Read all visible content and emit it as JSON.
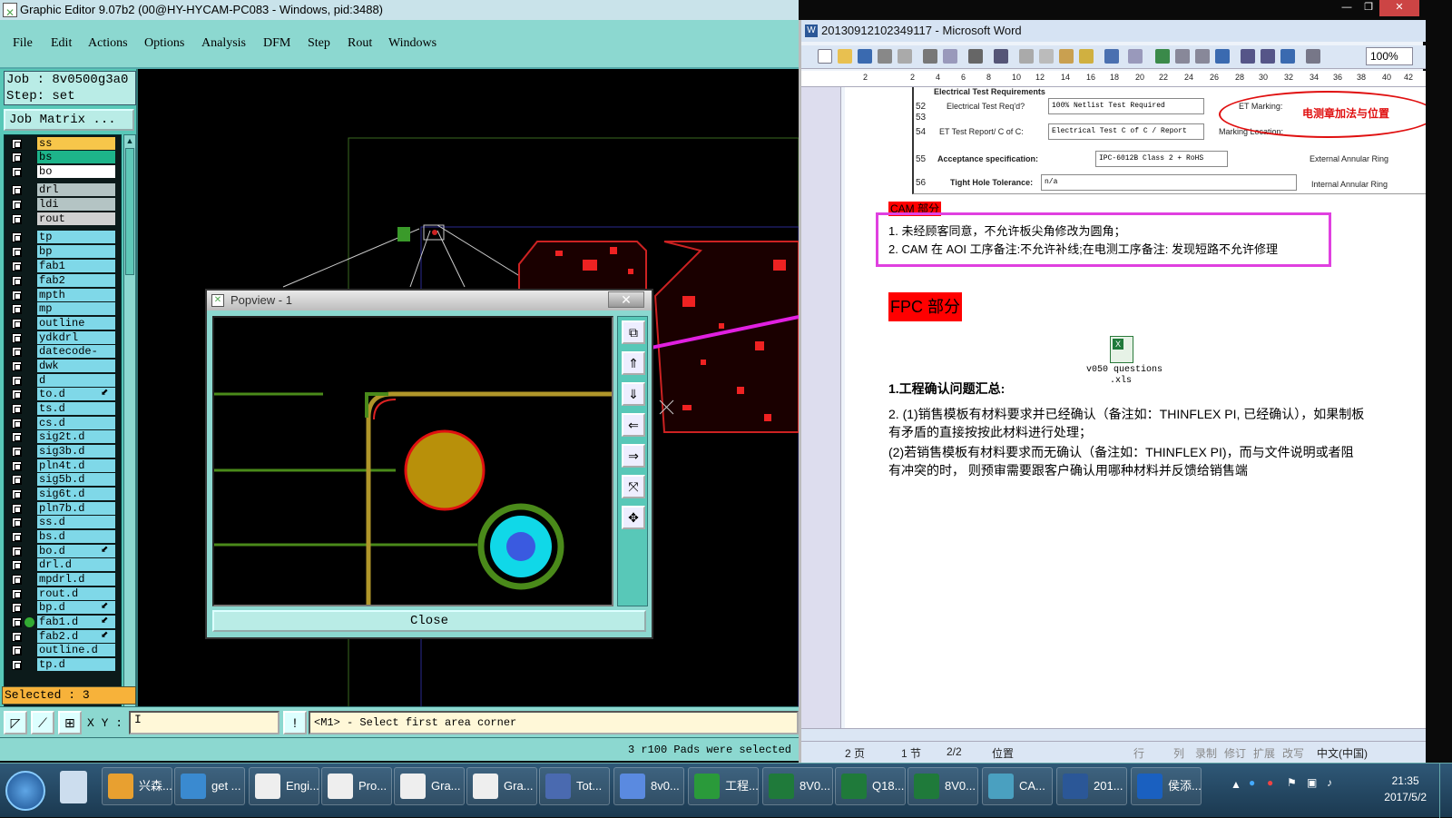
{
  "ge": {
    "title": "Graphic Editor 9.07b2 (00@HY-HYCAM-PC083 - Windows, pid:3488)",
    "menu": [
      "File",
      "Edit",
      "Actions",
      "Options",
      "Analysis",
      "DFM",
      "Step",
      "Rout",
      "Windows"
    ],
    "job": "Job : 8v0500g3a0",
    "step": "Step: set",
    "job_matrix": "Job Matrix ...",
    "layers": [
      {
        "name": "ss",
        "color": "#f7c64a"
      },
      {
        "name": "bs",
        "color": "#1db48a"
      },
      {
        "name": "bo",
        "color": "#ffffff"
      },
      {
        "name": "drl",
        "color": "#b4c4c4"
      },
      {
        "name": "ldi",
        "color": "#b4c4c4"
      },
      {
        "name": "rout",
        "color": "#d0d0d0"
      },
      {
        "name": "tp",
        "color": "#7fd8e8"
      },
      {
        "name": "bp",
        "color": "#7fd8e8"
      },
      {
        "name": "fab1",
        "color": "#7fd8e8"
      },
      {
        "name": "fab2",
        "color": "#7fd8e8"
      },
      {
        "name": "mpth",
        "color": "#7fd8e8"
      },
      {
        "name": "mp",
        "color": "#7fd8e8"
      },
      {
        "name": "outline",
        "color": "#7fd8e8"
      },
      {
        "name": "ydkdrl",
        "color": "#7fd8e8"
      },
      {
        "name": "datecode-pbe",
        "color": "#7fd8e8"
      },
      {
        "name": "dwk",
        "color": "#7fd8e8"
      },
      {
        "name": "d",
        "color": "#7fd8e8"
      },
      {
        "name": "to.d",
        "color": "#7fd8e8",
        "mark": "⬋"
      },
      {
        "name": "ts.d",
        "color": "#7fd8e8"
      },
      {
        "name": "cs.d",
        "color": "#7fd8e8"
      },
      {
        "name": "sig2t.d",
        "color": "#7fd8e8"
      },
      {
        "name": "sig3b.d",
        "color": "#7fd8e8"
      },
      {
        "name": "pln4t.d",
        "color": "#7fd8e8"
      },
      {
        "name": "sig5b.d",
        "color": "#7fd8e8"
      },
      {
        "name": "sig6t.d",
        "color": "#7fd8e8"
      },
      {
        "name": "pln7b.d",
        "color": "#7fd8e8"
      },
      {
        "name": "ss.d",
        "color": "#7fd8e8"
      },
      {
        "name": "bs.d",
        "color": "#7fd8e8"
      },
      {
        "name": "bo.d",
        "color": "#7fd8e8",
        "mark": "⬋"
      },
      {
        "name": "drl.d",
        "color": "#7fd8e8"
      },
      {
        "name": "mpdrl.d",
        "color": "#7fd8e8"
      },
      {
        "name": "rout.d",
        "color": "#7fd8e8"
      },
      {
        "name": "bp.d",
        "color": "#7fd8e8",
        "mark": "⬋"
      },
      {
        "name": "fab1.d",
        "color": "#7fd8e8",
        "mark": "⬋",
        "dot": true
      },
      {
        "name": "fab2.d",
        "color": "#7fd8e8",
        "mark": "⬋"
      },
      {
        "name": "outline.d",
        "color": "#7fd8e8"
      },
      {
        "name": "tp.d",
        "color": "#7fd8e8"
      }
    ],
    "selected": "Selected : 3",
    "xy_label": "X Y :",
    "prompt": "<M1> - Select first area corner",
    "status": "3 r100 Pads were selected",
    "popview_title": "Popview - 1",
    "popview_close": "Close"
  },
  "word": {
    "title": "20130912102349117 - Microsoft Word",
    "zoom": "100%",
    "ruler": [
      "2",
      "2",
      "4",
      "6",
      "8",
      "10",
      "12",
      "14",
      "16",
      "18",
      "20",
      "22",
      "24",
      "26",
      "28",
      "30",
      "32",
      "34",
      "36",
      "38",
      "40",
      "42"
    ],
    "form": {
      "row_cut": "Electrical Test Requirements",
      "r52": "52",
      "r53": "53",
      "r54": "54",
      "r55": "55",
      "r56": "56",
      "et_req_label": "Electrical Test Req'd?",
      "et_req_value": "100% Netlist Test Required",
      "et_report_label": "ET Test Report/ C of C:",
      "et_report_value": "Electrical Test C of C / Report",
      "accept_label": "Acceptance specification:",
      "accept_value": "IPC-6012B Class 2 + RoHS",
      "tight_label": "Tight Hole Tolerance:",
      "tight_value": "n/a",
      "et_marking": "ET Marking:",
      "marking_loc": "Marking Location:",
      "stamp_note": "电测章加法与位置",
      "ext_ring": "External Annular Ring",
      "int_ring": "Internal Annular Ring"
    },
    "cam_header": "CAM 部分",
    "items": [
      "1.   未经顾客同意，不允许板尖角修改为圆角；",
      "2.  CAM 在 AOI 工序备注:不允许补线;在电测工序备注: 发现短路不允许修理"
    ],
    "fpc_header": "FPC 部分",
    "xls_caption_1": "v050 questions",
    "xls_caption_2": ".xls",
    "section_title": "1.工程确认问题汇总:",
    "p1a": "2.  (1)销售模板有材料要求并已经确认（备注如：THINFLEX PI, 已经确认），如果制板",
    "p1b": "有矛盾的直接按按此材料进行处理；",
    "p2a": "   (2)若销售模板有材料要求而无确认（备注如：THINFLEX PI)，而与文件说明或者阻",
    "p2b": "有冲突的时，  则预审需要跟客户确认用哪种材料并反馈给销售端",
    "status": {
      "page": "2 页",
      "section": "1 节",
      "pages": "2/2",
      "pos": "位置",
      "row": "行",
      "col": "列",
      "rec": "录制",
      "rev": "修订",
      "ext": "扩展",
      "ovr": "改写",
      "lang": "中文(中国)"
    }
  },
  "taskbar": {
    "items": [
      "兴森...",
      "get ...",
      "Engi...",
      "Pro...",
      "Gra...",
      "Gra...",
      "Tot...",
      "8v0...",
      "工程...",
      "8V0...",
      "Q18...",
      "8V0...",
      "CA...",
      "201...",
      "侯添..."
    ],
    "time": "21:35",
    "date": "2017/5/2"
  }
}
